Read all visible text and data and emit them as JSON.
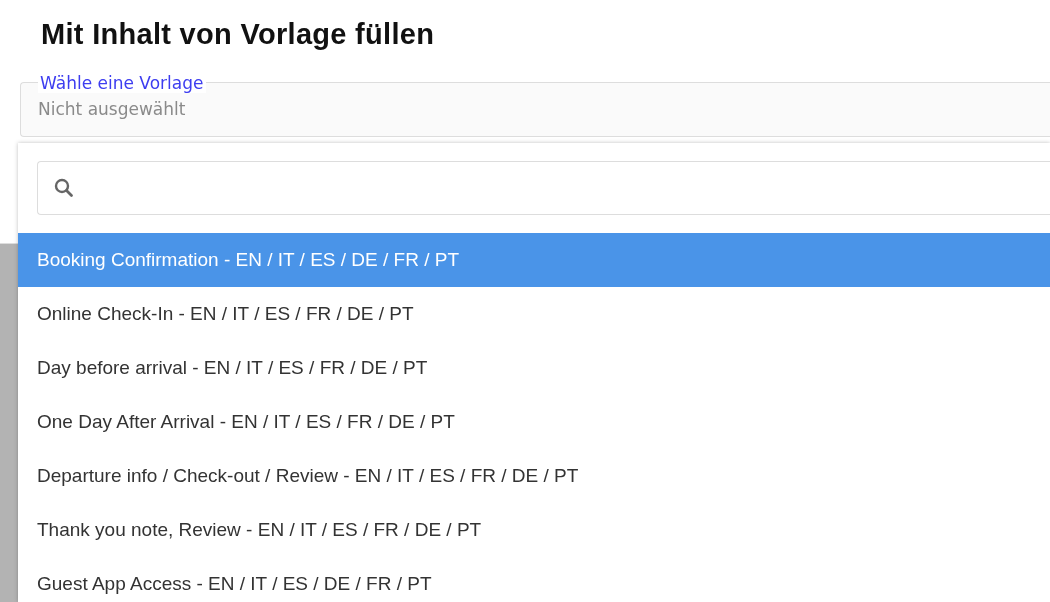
{
  "title": "Mit Inhalt von Vorlage füllen",
  "template_select": {
    "label": "Wähle eine Vorlage",
    "value": "Nicht ausgewählt"
  },
  "dropdown": {
    "options": [
      {
        "label": "Booking Confirmation - EN / IT / ES / DE / FR / PT",
        "selected": true
      },
      {
        "label": "Online Check-In - EN / IT / ES / FR / DE / PT",
        "selected": false
      },
      {
        "label": "Day before arrival - EN / IT / ES / FR / DE / PT",
        "selected": false
      },
      {
        "label": "One Day After Arrival - EN / IT / ES / FR / DE / PT",
        "selected": false
      },
      {
        "label": "Departure info / Check-out / Review - EN / IT / ES / FR / DE / PT",
        "selected": false
      },
      {
        "label": "Thank you note, Review - EN / IT / ES / FR / DE / PT",
        "selected": false
      },
      {
        "label": "Guest App Access - EN / IT / ES / DE / FR / PT",
        "selected": false
      }
    ]
  }
}
